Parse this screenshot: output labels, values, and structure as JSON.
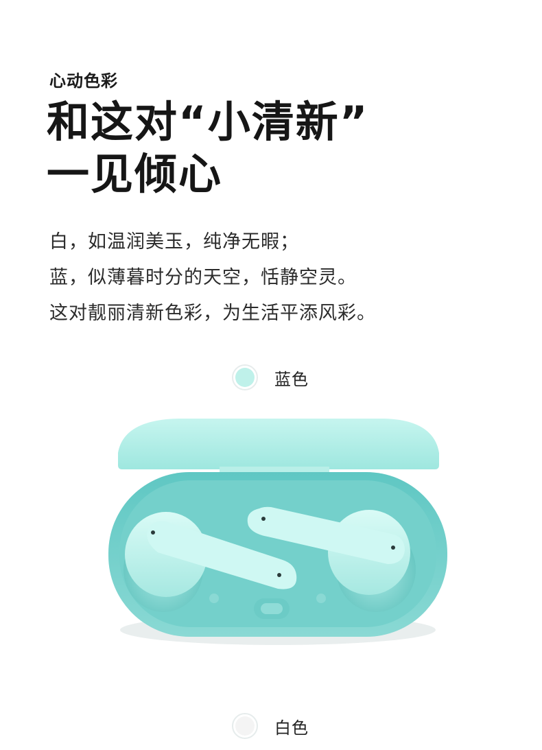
{
  "section": {
    "eyebrow": "心动色彩",
    "headline_line1": "和这对“小清新”",
    "headline_line2": "一见倾心",
    "body_lines": [
      "白，如温润美玉，纯净无暇；",
      "蓝，似薄暮时分的天空，恬静空灵。",
      "这对靓丽清新色彩，为生活平添风彩。"
    ]
  },
  "colors": [
    {
      "label": "蓝色",
      "swatch_color": "#bff1ea",
      "selected": true
    },
    {
      "label": "白色",
      "swatch_color": "#f4f4f4",
      "selected": false
    }
  ],
  "product": {
    "icon": "earbuds-charging-case",
    "case_color": "#7fd3cf",
    "lid_color": "#b3f0ea",
    "earbud_color": "#c8f4ef"
  }
}
